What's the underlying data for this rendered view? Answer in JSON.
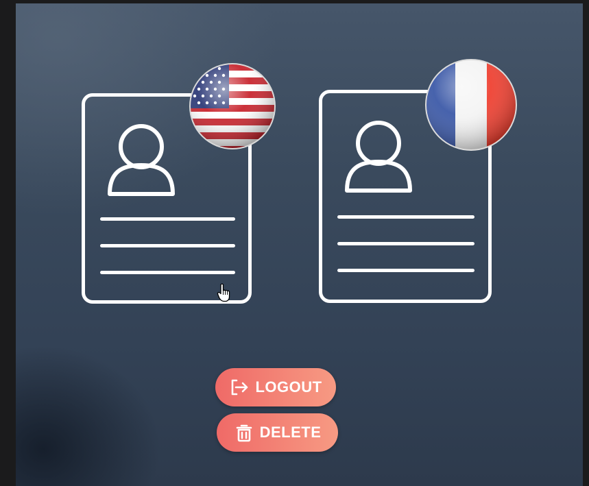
{
  "cards": [
    {
      "country": "United States",
      "flag_icon": "us-flag-icon"
    },
    {
      "country": "France",
      "flag_icon": "france-flag-icon"
    }
  ],
  "actions": {
    "logout_label": "LOGOUT",
    "delete_label": "DELETE"
  },
  "colors": {
    "background": "#3a4a5d",
    "button_start": "#ef6a67",
    "button_end": "#f79a83",
    "card_outline": "#ffffff"
  }
}
